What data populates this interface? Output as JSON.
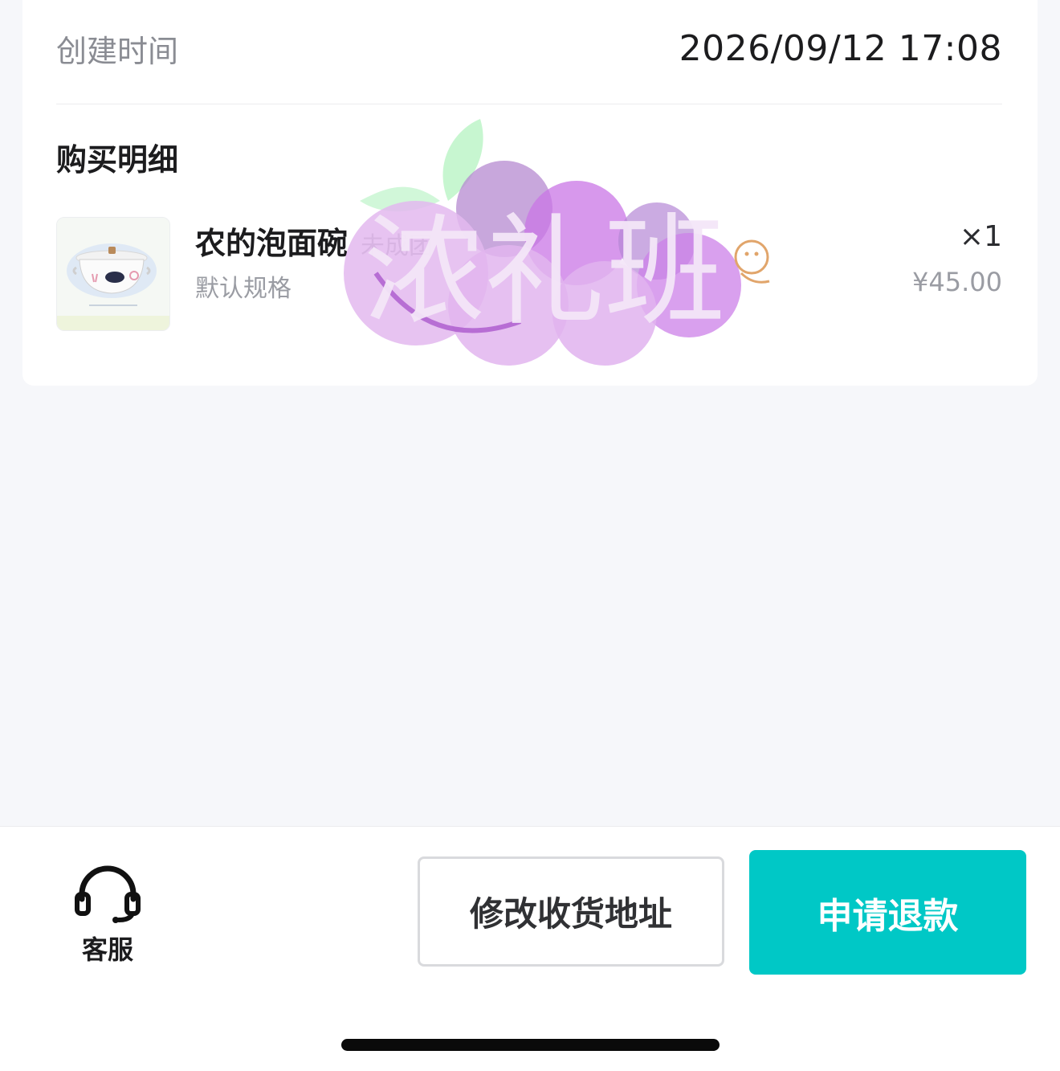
{
  "order": {
    "created_label": "创建时间",
    "created_value": "2026/09/12 17:08",
    "section_title": "购买明细"
  },
  "product": {
    "name": "农的泡面碗",
    "group_status": "未成团",
    "spec": "默认规格",
    "quantity": "×1",
    "price": "¥45.00"
  },
  "watermark": {
    "text": "浓礼班"
  },
  "bottom_bar": {
    "service_label": "客服",
    "change_address_label": "修改收货地址",
    "refund_label": "申请退款"
  },
  "colors": {
    "accent": "#00c8c6",
    "text_primary": "#1c1c1e",
    "text_secondary": "#9a9ca3",
    "background": "#f6f7fa"
  },
  "icons": [
    "headset-icon",
    "product-thumbnail",
    "watermark-logo"
  ]
}
